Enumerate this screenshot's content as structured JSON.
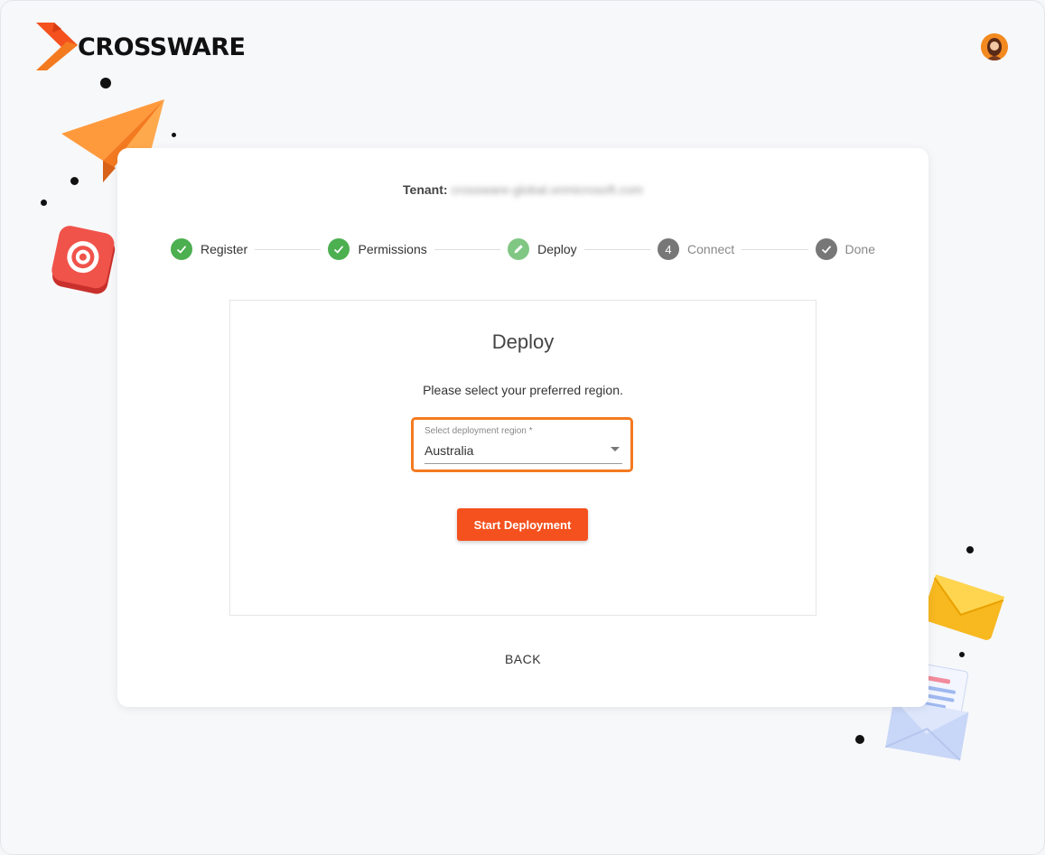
{
  "brand": {
    "name": "CROSSWARE"
  },
  "header": {
    "avatar_icon": "user-avatar"
  },
  "tenant": {
    "label": "Tenant:",
    "value": "crossware-global.onmicrosoft.com"
  },
  "stepper": {
    "steps": [
      {
        "label": "Register",
        "state": "done",
        "icon": "check-icon"
      },
      {
        "label": "Permissions",
        "state": "done",
        "icon": "check-icon"
      },
      {
        "label": "Deploy",
        "state": "active",
        "icon": "pencil-icon"
      },
      {
        "label": "Connect",
        "state": "pending",
        "number": "4"
      },
      {
        "label": "Done",
        "state": "pending",
        "icon": "check-icon"
      }
    ]
  },
  "deploy": {
    "title": "Deploy",
    "description": "Please select your preferred region.",
    "region_field": {
      "label": "Select deployment region *",
      "value": "Australia"
    },
    "start_button": "Start Deployment",
    "back_link": "BACK"
  },
  "colors": {
    "accent": "#f4511e",
    "highlight": "#f47a20",
    "step_done": "#4caf50",
    "step_active": "#81c784",
    "step_pending": "#777777"
  }
}
